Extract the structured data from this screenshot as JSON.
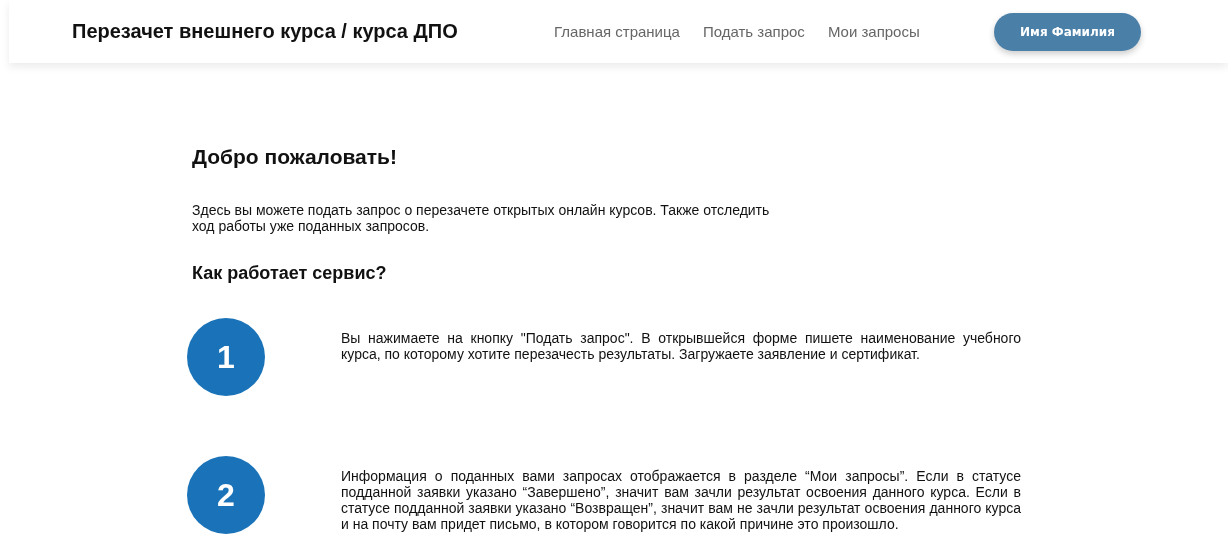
{
  "header": {
    "title": "Перезачет внешнего курса / курса ДПО",
    "nav": [
      {
        "label": "Главная страница"
      },
      {
        "label": "Подать запрос"
      },
      {
        "label": "Мои запросы"
      }
    ],
    "user_button": "Имя Фамилия"
  },
  "welcome": {
    "title": "Добро пожаловать!",
    "text": "Здесь вы можете подать запрос о перезачете открытых онлайн курсов. Также отследить ход работы уже поданных запросов.",
    "subtitle": "Как работает сервис?"
  },
  "steps": [
    {
      "number": "1",
      "text": "Вы нажимаете на кнопку \"Подать запрос\". В открывшейся форме пишете наименование учебного курса, по которому хотите перезачесть результаты. Загружаете заявление и сертификат."
    },
    {
      "number": "2",
      "text": "Информация о поданных вами запросах отображается в разделе “Мои запросы”. Если в статусе подданной заявки указано “Завершено”, значит вам зачли результат освоения данного курса. Если в статусе подданной заявки указано “Возвращен”, значит вам не зачли результат освоения данного курса и на почту вам придет письмо, в котором говорится по какой причине это произошло."
    }
  ]
}
